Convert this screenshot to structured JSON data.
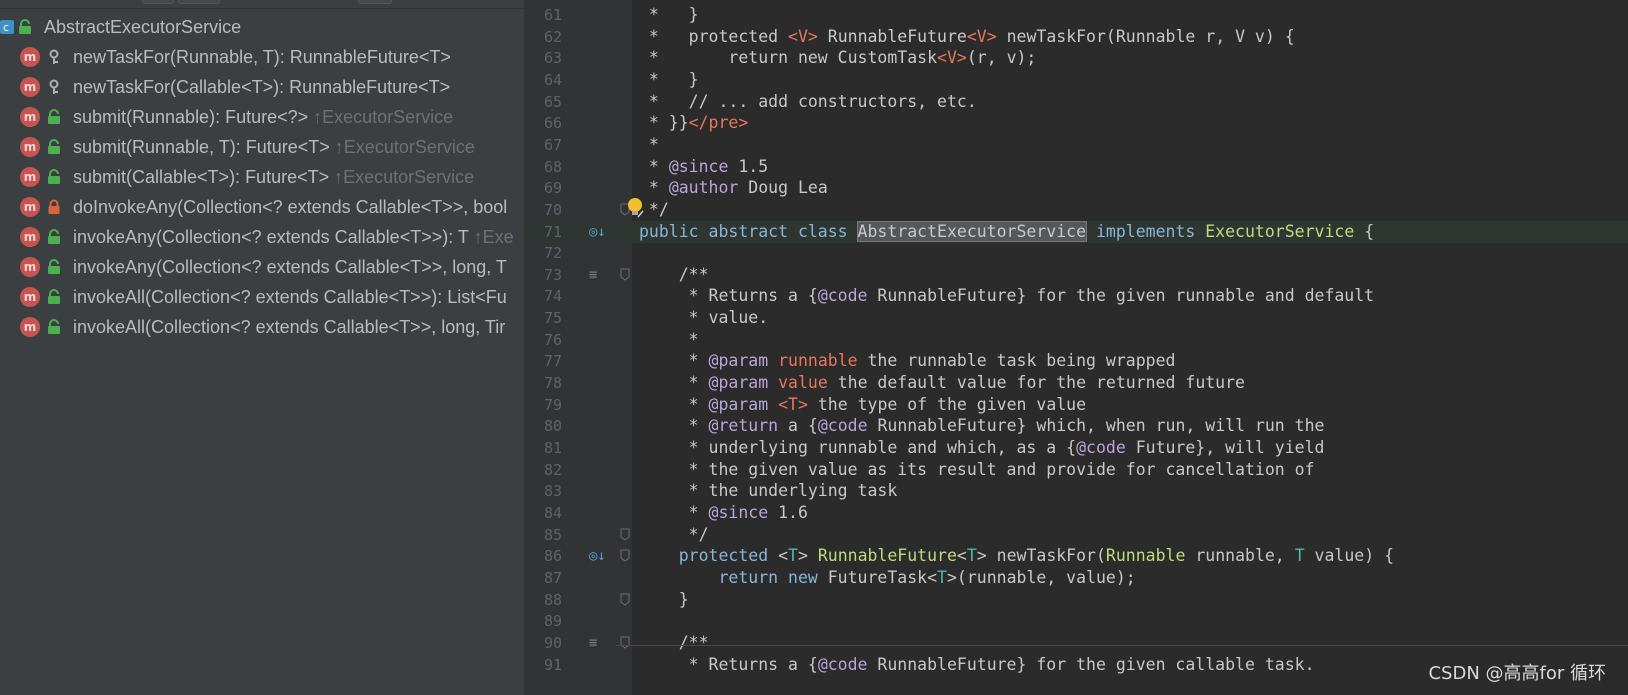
{
  "structure": {
    "root_label": "AbstractExecutorService",
    "items": [
      {
        "label": "newTaskFor(Runnable, T): RunnableFuture<T>",
        "inherited": "",
        "visibility": "protected"
      },
      {
        "label": "newTaskFor(Callable<T>): RunnableFuture<T>",
        "inherited": "",
        "visibility": "protected"
      },
      {
        "label": "submit(Runnable): Future<?>",
        "inherited": "↑ExecutorService",
        "visibility": "public"
      },
      {
        "label": "submit(Runnable, T): Future<T>",
        "inherited": "↑ExecutorService",
        "visibility": "public"
      },
      {
        "label": "submit(Callable<T>): Future<T>",
        "inherited": "↑ExecutorService",
        "visibility": "public"
      },
      {
        "label": "doInvokeAny(Collection<? extends Callable<T>>, bool",
        "inherited": "",
        "visibility": "private"
      },
      {
        "label": "invokeAny(Collection<? extends Callable<T>>): T",
        "inherited": "↑Exe",
        "visibility": "public"
      },
      {
        "label": "invokeAny(Collection<? extends Callable<T>>, long, T",
        "inherited": "",
        "visibility": "public"
      },
      {
        "label": "invokeAll(Collection<? extends Callable<T>>): List<Fu",
        "inherited": "",
        "visibility": "public"
      },
      {
        "label": "invokeAll(Collection<? extends Callable<T>>, long, Tir",
        "inherited": "",
        "visibility": "public"
      }
    ],
    "method_icon_letter": "m"
  },
  "editor": {
    "line_numbers": [
      "61",
      "62",
      "63",
      "64",
      "65",
      "66",
      "67",
      "68",
      "69",
      "70",
      "71",
      "72",
      "73",
      "74",
      "75",
      "76",
      "77",
      "78",
      "79",
      "80",
      "81",
      "82",
      "83",
      "84",
      "85",
      "86",
      "87",
      "88",
      "89",
      "90",
      "91"
    ],
    "lines": {
      "l61": " *   }",
      "l62a": " *   protected ",
      "l62b": "<V>",
      "l62c": " RunnableFuture",
      "l62d": "<V>",
      "l62e": " newTaskFor(Runnable r, V v) {",
      "l63a": " *       return new CustomTask",
      "l63b": "<V>",
      "l63c": "(r, v);",
      "l64": " *   }",
      "l65": " *   // ... add constructors, etc.",
      "l66a": " * }}",
      "l66b": "</pre>",
      "l67": " *",
      "l68a": " * ",
      "l68b": "@since",
      "l68c": " 1.5",
      "l69a": " * ",
      "l69b": "@author",
      "l69c": " Doug Lea",
      "l70": " */",
      "l71_kw": "public abstract class ",
      "l71_cls": "AbstractExecutorService",
      "l71_impl": " implements ",
      "l71_iface": "ExecutorService",
      "l71_end": " {",
      "l73": "    /**",
      "l74a": "     * Returns a {",
      "l74b": "@code",
      "l74c": " RunnableFuture} for the given runnable and default",
      "l75": "     * value.",
      "l76": "     *",
      "l77a": "     * ",
      "l77b": "@param",
      "l77c": " runnable",
      "l77d": " the runnable task being wrapped",
      "l78a": "     * ",
      "l78b": "@param",
      "l78c": " value",
      "l78d": " the default value for the returned future",
      "l79a": "     * ",
      "l79b": "@param",
      "l79c": " <T>",
      "l79d": " the type of the given value",
      "l80a": "     * ",
      "l80b": "@return",
      "l80c": " a {",
      "l80d": "@code",
      "l80e": " RunnableFuture} which, when run, will run the",
      "l81a": "     * underlying runnable and which, as a {",
      "l81b": "@code",
      "l81c": " Future}, will yield",
      "l82": "     * the given value as its result and provide for cancellation of",
      "l83": "     * the underlying task",
      "l84a": "     * ",
      "l84b": "@since",
      "l84c": " 1.6",
      "l85": "     */",
      "l86a": "    protected ",
      "l86b": "<",
      "l86c": "T",
      "l86d": "> ",
      "l86e": "RunnableFuture",
      "l86f": "<",
      "l86g": "T",
      "l86h": "> newTaskFor(",
      "l86i": "Runnable",
      "l86j": " runnable, ",
      "l86k": "T",
      "l86l": " value) {",
      "l87a": "        return new ",
      "l87b": "FutureTask<",
      "l87c": "T",
      "l87d": ">(runnable, value);",
      "l88": "    }",
      "l90": "    /**",
      "l91a": "     * Returns a {",
      "l91b": "@code",
      "l91c": " RunnableFuture} for the given callable task."
    }
  },
  "watermark": "CSDN @高高for 循环",
  "colors": {
    "panel_bg": "#3c3f41",
    "editor_bg": "#2b2b2b",
    "method_icon": "#c75450",
    "lock_public": "#4caf50",
    "lock_private": "#d9653b"
  }
}
